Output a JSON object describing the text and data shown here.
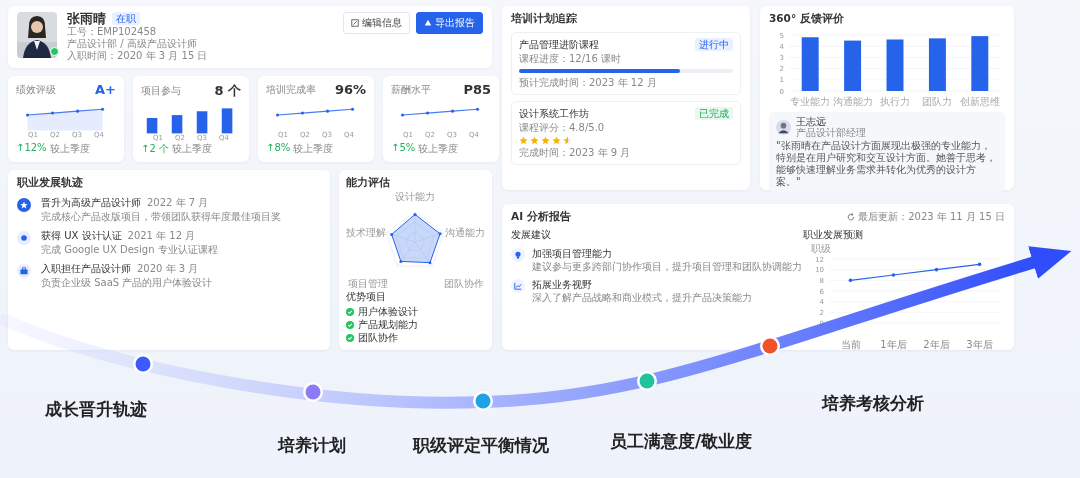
{
  "profile": {
    "name": "张雨晴",
    "status": "在职",
    "employee_id": "工号：EMP102458",
    "department": "产品设计部 / 高级产品设计师",
    "hire_date": "入职时间：2020 年 3 月 15 日",
    "online": true,
    "buttons": [
      {
        "label": "编辑信息",
        "kind": "secondary"
      },
      {
        "label": "导出报告",
        "kind": "primary"
      }
    ]
  },
  "kpis": [
    {
      "title": "绩效评级",
      "value": "A+",
      "accent": true,
      "kind": "area",
      "quarters": [
        "Q1",
        "Q2",
        "Q3",
        "Q4"
      ],
      "change": "↑12%",
      "note": "较上季度"
    },
    {
      "title": "项目参与",
      "value": "8 个",
      "accent": false,
      "kind": "bar",
      "quarters": [
        "Q1",
        "Q2",
        "Q3",
        "Q4"
      ],
      "change": "↑2 个",
      "note": "较上季度"
    },
    {
      "title": "培训完成率",
      "value": "96%",
      "accent": false,
      "kind": "line",
      "quarters": [
        "Q1",
        "Q2",
        "Q3",
        "Q4"
      ],
      "change": "↑8%",
      "note": "较上季度"
    },
    {
      "title": "薪酬水平",
      "value": "P85",
      "accent": false,
      "kind": "line",
      "quarters": [
        "Q1",
        "Q2",
        "Q3",
        "Q4"
      ],
      "change": "↑5%",
      "note": "较上季度"
    }
  ],
  "career": {
    "title": "职业发展轨迹",
    "events": [
      {
        "title": "晋升为高级产品设计师",
        "date": "2022 年 7 月",
        "desc": "完成核心产品改版项目，带领团队获得年度最佳项目奖",
        "current": true
      },
      {
        "title": "获得 UX 设计认证",
        "date": "2021 年 12 月",
        "desc": "完成 Google UX Design 专业认证课程",
        "current": false
      },
      {
        "title": "入职担任产品设计师",
        "date": "2020 年 3 月",
        "desc": "负责企业级 SaaS 产品的用户体验设计",
        "current": false
      }
    ]
  },
  "ability": {
    "title": "能力评估",
    "axes": [
      "设计能力",
      "沟通能力",
      "团队协作",
      "项目管理",
      "技术理解"
    ],
    "strengths_title": "优势项目",
    "strengths": [
      "用户体验设计",
      "产品规划能力",
      "团队协作"
    ]
  },
  "training": {
    "title": "培训计划追踪",
    "courses": [
      {
        "kind": "progress",
        "title": "产品管理进阶课程",
        "status": "进行中",
        "completed": false,
        "detail": "课程进度：12/16 课时",
        "level": 0.75,
        "date": "预计完成时间：2023 年 12 月"
      },
      {
        "kind": "rating",
        "title": "设计系统工作坊",
        "status": "已完成",
        "completed": true,
        "detail": "课程评分：4.8/5.0",
        "stars": 4.5,
        "date": "完成时间：2023 年 9 月"
      }
    ]
  },
  "feedback": {
    "title": "360° 反馈评价",
    "chart_data": {
      "type": "bar",
      "categories": [
        "专业能力",
        "沟通能力",
        "执行力",
        "团队力",
        "创新思维"
      ],
      "values": [
        4.8,
        4.5,
        4.6,
        4.7,
        4.9
      ],
      "ylim": [
        0,
        5
      ],
      "yticks": [
        0,
        1,
        2,
        3,
        4,
        5
      ],
      "grid": true
    },
    "comment": {
      "name": "王志远",
      "role": "产品设计部经理",
      "quote": "\"张雨晴在产品设计方面展现出极强的专业能力，特别是在用户研究和交互设计方面。她善于思考，能够快速理解业务需求并转化为优秀的设计方案。\""
    }
  },
  "ai": {
    "title": "AI 分析报告",
    "updated": "最后更新：2023 年 11 月 15 日",
    "suggestions_title": "发展建议",
    "suggestions": [
      {
        "title": "加强项目管理能力",
        "desc": "建议参与更多跨部门协作项目，提升项目管理和团队协调能力"
      },
      {
        "title": "拓展业务视野",
        "desc": "深入了解产品战略和商业模式，提升产品决策能力"
      }
    ],
    "forecast": {
      "title": "职业发展预测",
      "chart_data": {
        "type": "line",
        "ylabel": "职级",
        "categories": [
          "当前",
          "1年后",
          "2年后",
          "3年后"
        ],
        "values": [
          8,
          9,
          10,
          11
        ],
        "ylim": [
          0,
          12
        ],
        "yticks": [
          0,
          2,
          4,
          6,
          8,
          10,
          12
        ],
        "grid": true
      }
    }
  },
  "milestones": [
    {
      "label": "成长晋升轨迹",
      "color": "#3d5afe"
    },
    {
      "label": "培养计划",
      "color": "#8b7cf6"
    },
    {
      "label": "职级评定平衡情况",
      "color": "#1fa3e6"
    },
    {
      "label": "员工满意度/敬业度",
      "color": "#22c39a"
    },
    {
      "label": "培养考核分析",
      "color": "#f0532b"
    }
  ]
}
